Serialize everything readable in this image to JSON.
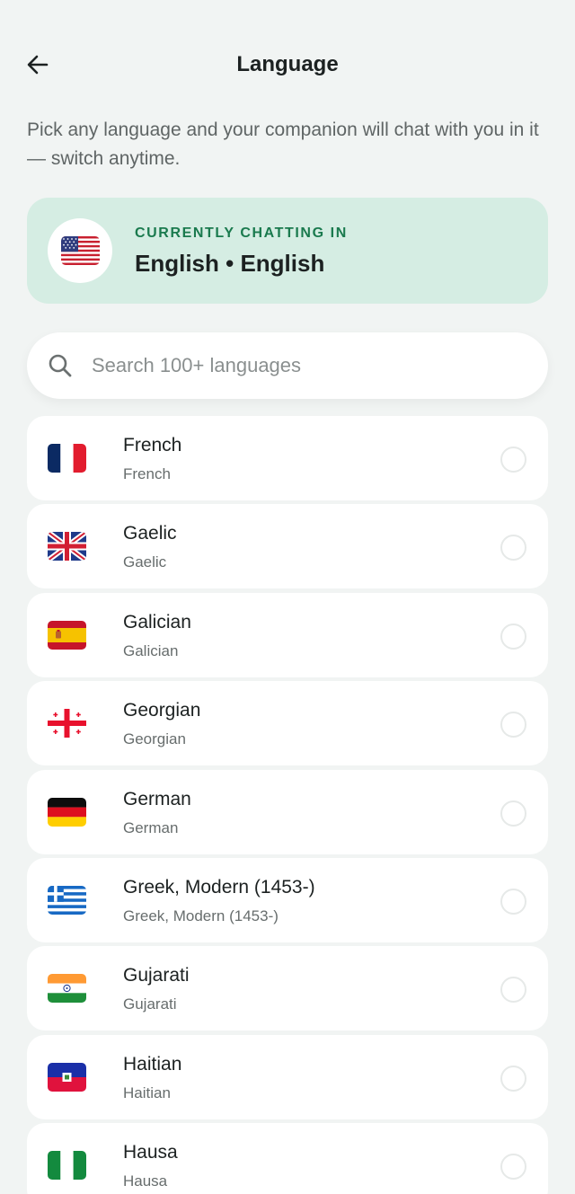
{
  "header": {
    "title": "Language",
    "back_icon": "arrow-left-icon"
  },
  "intro": "Pick any language and your companion will chat with you in it — switch anytime.",
  "current": {
    "kicker": "CURRENTLY CHATTING IN",
    "value": "English • English",
    "flag": "us-flag-icon"
  },
  "search": {
    "placeholder": "Search 100+ languages",
    "value": "",
    "icon": "search-icon"
  },
  "languages": [
    {
      "name": "French",
      "native": "French",
      "flag": "fr",
      "selected": false
    },
    {
      "name": "Gaelic",
      "native": "Gaelic",
      "flag": "gb",
      "selected": false
    },
    {
      "name": "Galician",
      "native": "Galician",
      "flag": "es",
      "selected": false
    },
    {
      "name": "Georgian",
      "native": "Georgian",
      "flag": "ge",
      "selected": false
    },
    {
      "name": "German",
      "native": "German",
      "flag": "de",
      "selected": false
    },
    {
      "name": "Greek, Modern (1453-)",
      "native": "Greek, Modern (1453-)",
      "flag": "gr",
      "selected": false
    },
    {
      "name": "Gujarati",
      "native": "Gujarati",
      "flag": "in",
      "selected": false
    },
    {
      "name": "Haitian",
      "native": "Haitian",
      "flag": "ht",
      "selected": false
    },
    {
      "name": "Hausa",
      "native": "Hausa",
      "flag": "ng",
      "selected": false
    }
  ],
  "colors": {
    "background": "#f1f4f3",
    "accent": "#1a7a4e",
    "current_card": "#d5ede3"
  }
}
